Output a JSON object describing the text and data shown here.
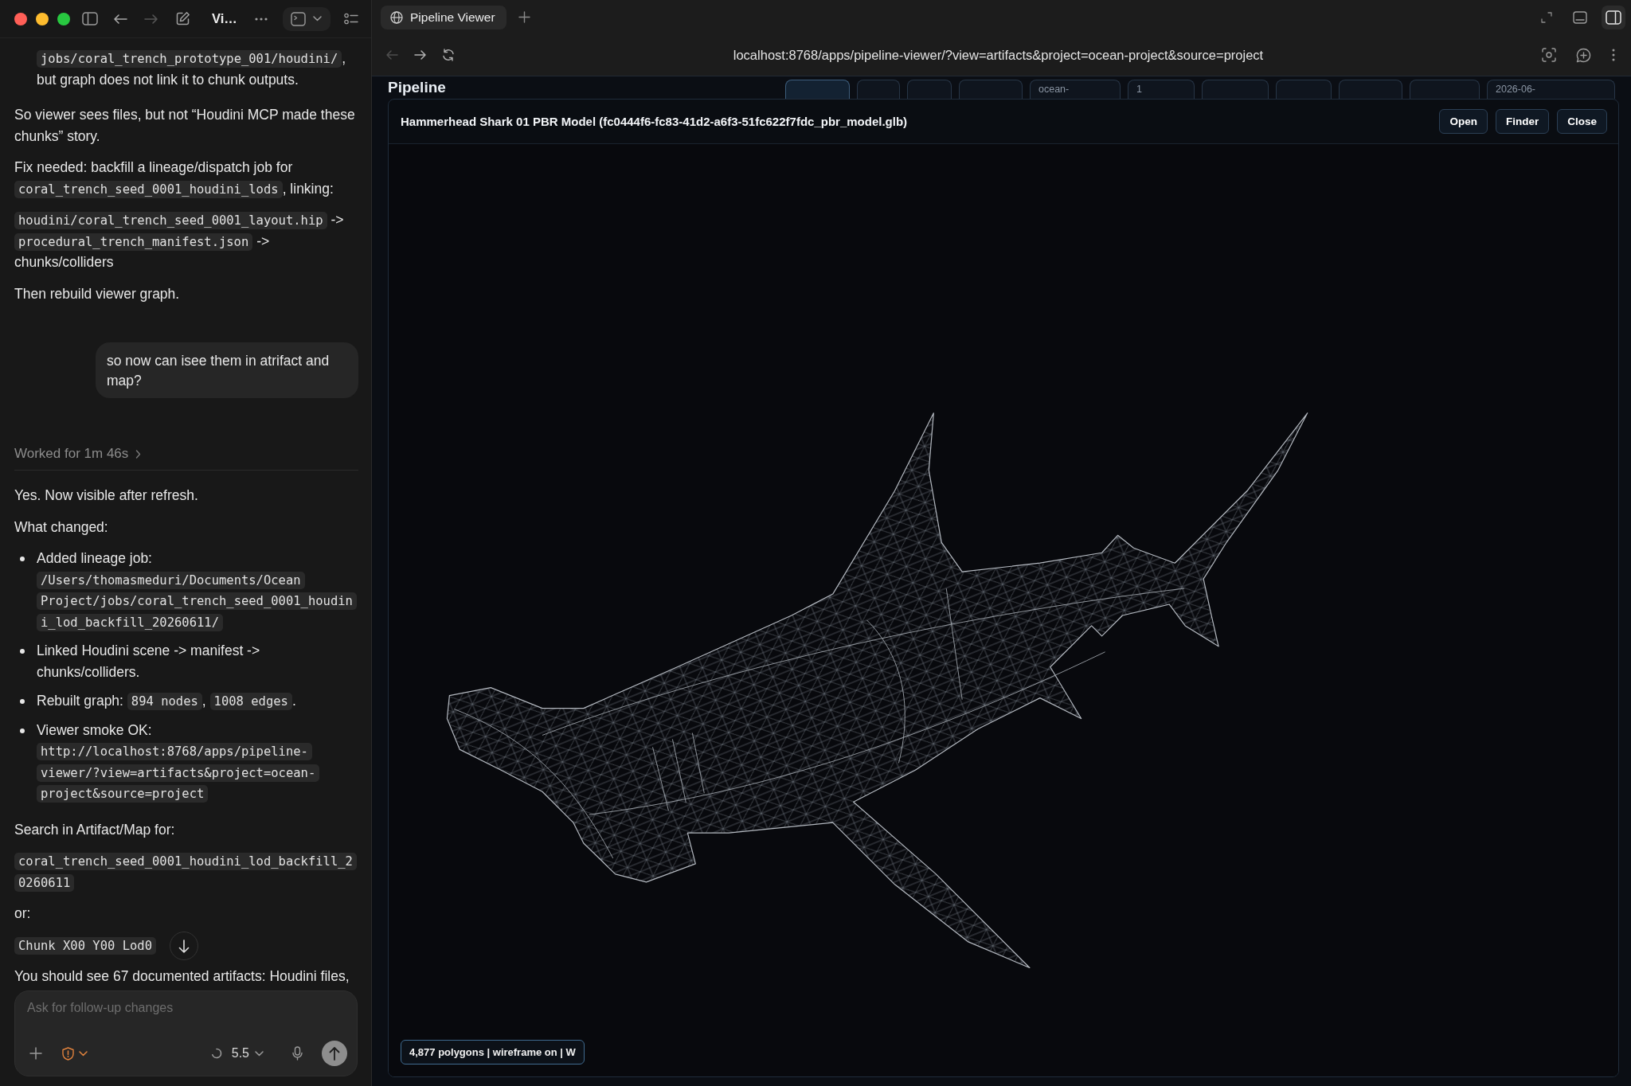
{
  "chat": {
    "window_buttons": [
      {
        "color": "#ff5f57"
      },
      {
        "color": "#febc2e"
      },
      {
        "color": "#28c840"
      }
    ],
    "nav": [
      {
        "kind": "back",
        "disabled": false
      },
      {
        "kind": "forward",
        "disabled": true
      }
    ],
    "title": "Vi…",
    "messages": [
      {
        "kind": "list_continuation",
        "segments": [
          {
            "kind": "code",
            "text": "jobs/coral_trench_prototype_001/houdini/"
          },
          {
            "kind": "text",
            "text": ", but graph does not link it to chunk outputs."
          }
        ]
      },
      {
        "kind": "paragraph",
        "segments": [
          {
            "kind": "text",
            "text": "So viewer sees files, but not “Houdini MCP made these chunks” story."
          }
        ]
      },
      {
        "kind": "paragraph",
        "segments": [
          {
            "kind": "text",
            "text": "Fix needed: backfill a lineage/dispatch job for "
          },
          {
            "kind": "code",
            "text": "coral_trench_seed_0001_houdini_lods"
          },
          {
            "kind": "text",
            "text": ", linking:"
          }
        ]
      },
      {
        "kind": "paragraph",
        "segments": [
          {
            "kind": "code",
            "text": "houdini/coral_trench_seed_0001_layout.hip"
          },
          {
            "kind": "text",
            "text": " -> "
          },
          {
            "kind": "code",
            "text": "procedural_trench_manifest.json"
          },
          {
            "kind": "text",
            "text": " -> chunks/colliders"
          }
        ]
      },
      {
        "kind": "paragraph",
        "segments": [
          {
            "kind": "text",
            "text": "Then rebuild viewer graph."
          }
        ]
      },
      {
        "kind": "user",
        "text": "so now can isee them in atrifact and map?"
      },
      {
        "kind": "worked",
        "text": "Worked for 1m 46s"
      },
      {
        "kind": "paragraph",
        "segments": [
          {
            "kind": "text",
            "text": "Yes. Now visible after refresh."
          }
        ]
      },
      {
        "kind": "paragraph",
        "segments": [
          {
            "kind": "text",
            "text": "What changed:"
          }
        ]
      },
      {
        "kind": "list",
        "items": [
          {
            "segments": [
              {
                "kind": "text",
                "text": "Added lineage job: "
              },
              {
                "kind": "code",
                "text": "/Users/thomasmeduri/Documents/Ocean Project/jobs/coral_trench_seed_0001_houdini_lod_backfill_20260611/"
              }
            ]
          },
          {
            "segments": [
              {
                "kind": "text",
                "text": "Linked Houdini scene -> manifest -> chunks/colliders."
              }
            ]
          },
          {
            "segments": [
              {
                "kind": "text",
                "text": "Rebuilt graph: "
              },
              {
                "kind": "code",
                "text": "894 nodes"
              },
              {
                "kind": "text",
                "text": ", "
              },
              {
                "kind": "code",
                "text": "1008 edges"
              },
              {
                "kind": "text",
                "text": "."
              }
            ]
          },
          {
            "segments": [
              {
                "kind": "text",
                "text": "Viewer smoke OK: "
              },
              {
                "kind": "code",
                "text": "http://localhost:8768/apps/pipeline-viewer/?view=artifacts&project=ocean-project&source=project"
              }
            ]
          }
        ]
      },
      {
        "kind": "paragraph",
        "segments": [
          {
            "kind": "text",
            "text": "Search in Artifact/Map for:"
          }
        ]
      },
      {
        "kind": "paragraph",
        "segments": [
          {
            "kind": "code",
            "text": "coral_trench_seed_0001_houdini_lod_backfill_20260611"
          }
        ]
      },
      {
        "kind": "paragraph",
        "segments": [
          {
            "kind": "text",
            "text": "or:"
          }
        ]
      },
      {
        "kind": "paragraph",
        "segments": [
          {
            "kind": "code",
            "text": "Chunk X00 Y00 Lod0"
          }
        ]
      },
      {
        "kind": "paragraph",
        "segments": [
          {
            "kind": "text",
            "text": "You should see 67 documented artifacts: Houdini files,"
          }
        ]
      }
    ],
    "composer": {
      "placeholder": "Ask for follow-up changes",
      "model": "5.5"
    }
  },
  "browser": {
    "tabs": [
      {
        "title": "Pipeline Viewer",
        "selected": true
      }
    ],
    "nav": [
      {
        "kind": "back",
        "disabled": true
      },
      {
        "kind": "forward",
        "disabled": false
      },
      {
        "kind": "reload",
        "disabled": false
      }
    ],
    "url": "localhost:8768/apps/pipeline-viewer/?view=artifacts&project=ocean-project&source=project",
    "page": {
      "heading": "Pipeline",
      "cells": [
        {
          "kind": "pill",
          "selected": true
        },
        {
          "kind": "pill",
          "selected": false
        },
        {
          "kind": "pill",
          "selected": false
        },
        {
          "kind": "pill",
          "selected": false
        },
        {
          "kind": "cell",
          "text": "ocean-"
        },
        {
          "kind": "cell",
          "text": "1"
        },
        {
          "kind": "cell"
        },
        {
          "kind": "cell"
        },
        {
          "kind": "cell"
        },
        {
          "kind": "cell"
        },
        {
          "kind": "cell",
          "text": "2026-06-"
        }
      ]
    }
  },
  "dialog": {
    "title": "Hammerhead Shark 01 PBR Model (fc0444f6-fc83-41d2-a6f3-51fc622f7fdc_pbr_model.glb)",
    "buttons": [
      "Open",
      "Finder",
      "Close"
    ],
    "status": "4,877 polygons | wireframe on | W"
  }
}
